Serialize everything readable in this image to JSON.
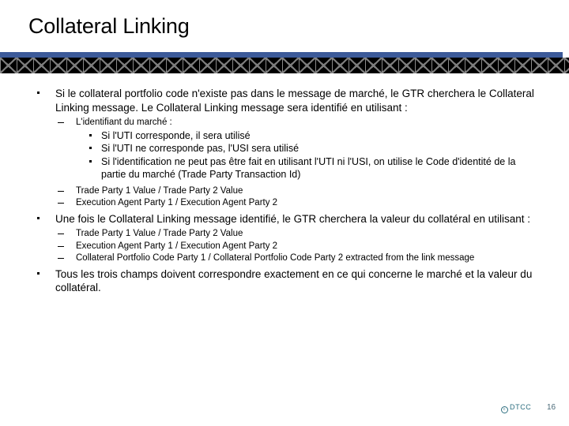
{
  "slide": {
    "title": "Collateral Linking",
    "bullets": [
      {
        "level": 1,
        "text": "Si le collateral portfolio code n'existe pas dans le message de marché, le GTR cherchera le Collateral Linking message. Le Collateral Linking message sera identifié en utilisant :"
      },
      {
        "level": 2,
        "text": "L'identifiant du marché :"
      },
      {
        "level": 3,
        "text": "Si l'UTI corresponde, il sera utilisé"
      },
      {
        "level": 3,
        "text": "Si l'UTI ne corresponde pas, l'USI sera utilisé"
      },
      {
        "level": 3,
        "text": "Si l'identification ne peut pas être fait en utilisant l'UTI ni l'USI, on utilise le Code d'identité de la partie du marché (Trade Party Transaction Id)"
      },
      {
        "level": 2,
        "text": "Trade Party 1 Value / Trade Party 2 Value"
      },
      {
        "level": 2,
        "text": "Execution Agent Party 1 / Execution Agent Party 2"
      },
      {
        "level": 1,
        "text": "Une fois le Collateral Linking message identifié, le GTR cherchera la valeur du collatéral en utilisant :"
      },
      {
        "level": 2,
        "text": "Trade Party 1 Value / Trade Party 2 Value"
      },
      {
        "level": 2,
        "text": "Execution Agent Party 1 / Execution Agent Party 2"
      },
      {
        "level": 2,
        "text": "Collateral Portfolio Code Party 1 / Collateral Portfolio Code Party 2 extracted from the link message"
      },
      {
        "level": 1,
        "text": "Tous les trois champs doivent correspondre exactement en ce qui concerne le marché et la valeur du collatéral."
      }
    ]
  },
  "footer": {
    "copyright_mark": "c",
    "brand": "DTCC",
    "page_number": "16"
  },
  "colors": {
    "band_blue": "#3c5a99",
    "band_black": "#000000",
    "band_truss_line": "#7d7d7d",
    "footer_teal": "#2e6f80",
    "text": "#000000"
  }
}
